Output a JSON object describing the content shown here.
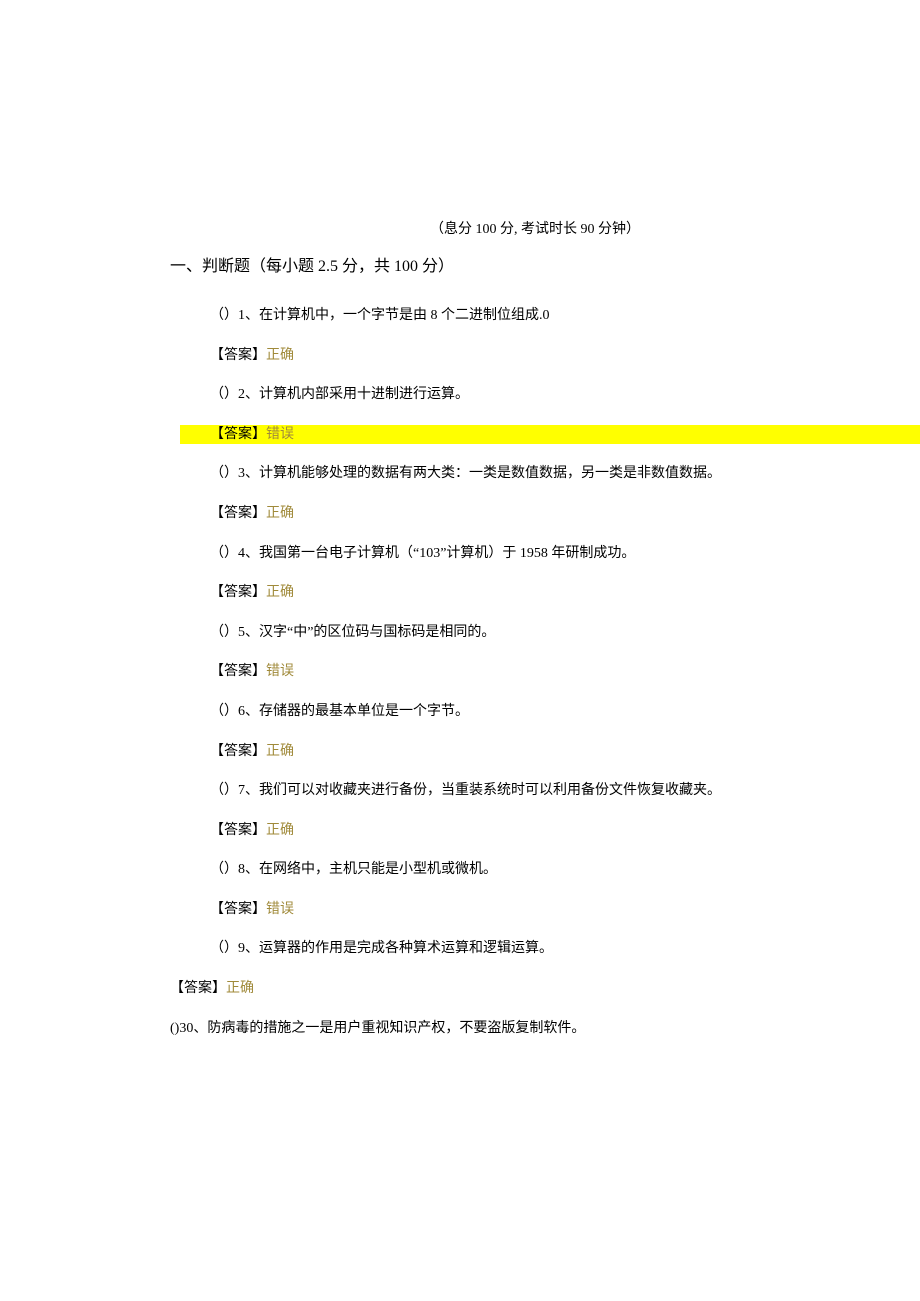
{
  "meta": {
    "line": "（息分 100 分, 考试时长 90 分钟）"
  },
  "section": {
    "title": "一、判断题（每小题 2.5 分，共 100 分）"
  },
  "answer_labels": {
    "prefix": "【答案】",
    "correct": "正确",
    "wrong": "错误"
  },
  "questions": [
    {
      "text": "（）1、在计算机中，一个字节是由 8 个二进制位组成.0",
      "answer": "correct",
      "highlight_answer": false
    },
    {
      "text": "（）2、计算机内部采用十进制进行运算。",
      "answer": "wrong",
      "highlight_answer": true
    },
    {
      "text": "（）3、计算机能够处理的数据有两大类：一类是数值数据，另一类是非数值数据。",
      "answer": "correct",
      "highlight_answer": false
    },
    {
      "text": "（）4、我国第一台电子计算机（“103”计算机）于 1958 年研制成功。",
      "answer": "correct",
      "highlight_answer": false
    },
    {
      "text": "（）5、汉字“中”的区位码与国标码是相同的。",
      "answer": "wrong",
      "highlight_answer": false
    },
    {
      "text": "（）6、存储器的最基本单位是一个字节。",
      "answer": "correct",
      "highlight_answer": false
    },
    {
      "text": "（）7、我们可以对收藏夹进行备份，当重装系统时可以利用备份文件恢复收藏夹。",
      "answer": "correct",
      "highlight_answer": false
    },
    {
      "text": "（）8、在网络中，主机只能是小型机或微机。",
      "answer": "wrong",
      "highlight_answer": false
    },
    {
      "text": "（）9、运算器的作用是完成各种算术运算和逻辑运算。",
      "answer": "correct",
      "highlight_answer": false,
      "outdent_answer": true
    }
  ],
  "tail_question": {
    "text": "()30、防病毒的措施之一是用户重视知识产权，不要盗版复制软件。"
  }
}
